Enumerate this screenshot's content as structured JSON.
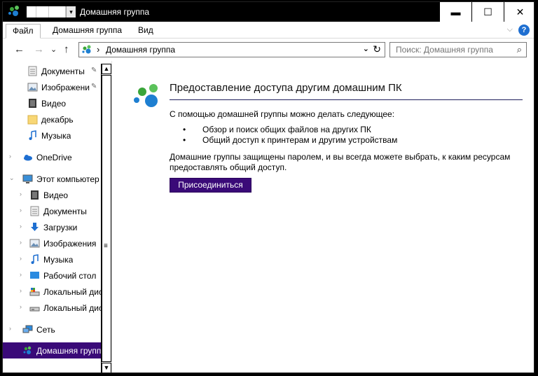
{
  "window": {
    "title": "Домашняя группа",
    "controls": {
      "minimize": "▬",
      "maximize": "☐",
      "close": "✕"
    }
  },
  "ribbon": {
    "tabs": [
      {
        "label": "Файл",
        "active": true
      },
      {
        "label": "Домашняя группа",
        "active": false
      },
      {
        "label": "Вид",
        "active": false
      }
    ],
    "collapse": "⌵",
    "help": "?"
  },
  "navbar": {
    "back": "←",
    "forward": "→",
    "recent": "⌄",
    "up": "↑",
    "breadcrumb_sep": "›",
    "path": "Домашняя группа",
    "dropdown": "⌄",
    "refresh": "↻",
    "search_placeholder": "Поиск: Домашняя группа",
    "search_icon": "⌕"
  },
  "navpane": {
    "items": [
      {
        "label": "Документы",
        "icon": "documents-icon",
        "pinned": true
      },
      {
        "label": "Изображени",
        "icon": "pictures-icon",
        "pinned": true
      },
      {
        "label": "Видео",
        "icon": "video-icon",
        "pinned": false
      },
      {
        "label": "декабрь",
        "icon": "folder-icon",
        "pinned": false
      },
      {
        "label": "Музыка",
        "icon": "music-icon",
        "pinned": false
      },
      {
        "label": "OneDrive",
        "icon": "onedrive-icon"
      },
      {
        "label": "Этот компьютер",
        "icon": "computer-icon"
      },
      {
        "label": "Видео",
        "icon": "video-icon"
      },
      {
        "label": "Документы",
        "icon": "documents-icon"
      },
      {
        "label": "Загрузки",
        "icon": "downloads-icon"
      },
      {
        "label": "Изображения",
        "icon": "pictures-icon"
      },
      {
        "label": "Музыка",
        "icon": "music-icon"
      },
      {
        "label": "Рабочий стол",
        "icon": "desktop-icon"
      },
      {
        "label": "Локальный дис",
        "icon": "drive-c-icon"
      },
      {
        "label": "Локальный дис",
        "icon": "drive-icon"
      },
      {
        "label": "Сеть",
        "icon": "network-icon"
      },
      {
        "label": "Домашняя групп",
        "icon": "homegroup-icon",
        "selected": true
      }
    ],
    "pin_glyph": "📌"
  },
  "content": {
    "heading": "Предоставление доступа другим домашним ПК",
    "intro": "С помощью домашней группы можно делать следующее:",
    "bullets": [
      "Обзор и поиск общих файлов на других ПК",
      "Общий доступ к принтерам и другим устройствам"
    ],
    "description": "Домашние группы защищены паролем, и вы всегда можете выбрать, к каким ресурсам предоставлять общий доступ.",
    "join_button": "Присоединиться"
  },
  "colors": {
    "accent": "#3a0a78",
    "titlebar": "#000000",
    "homegroup_green": "#3aa53a",
    "homegroup_blue": "#1e7fd1"
  }
}
